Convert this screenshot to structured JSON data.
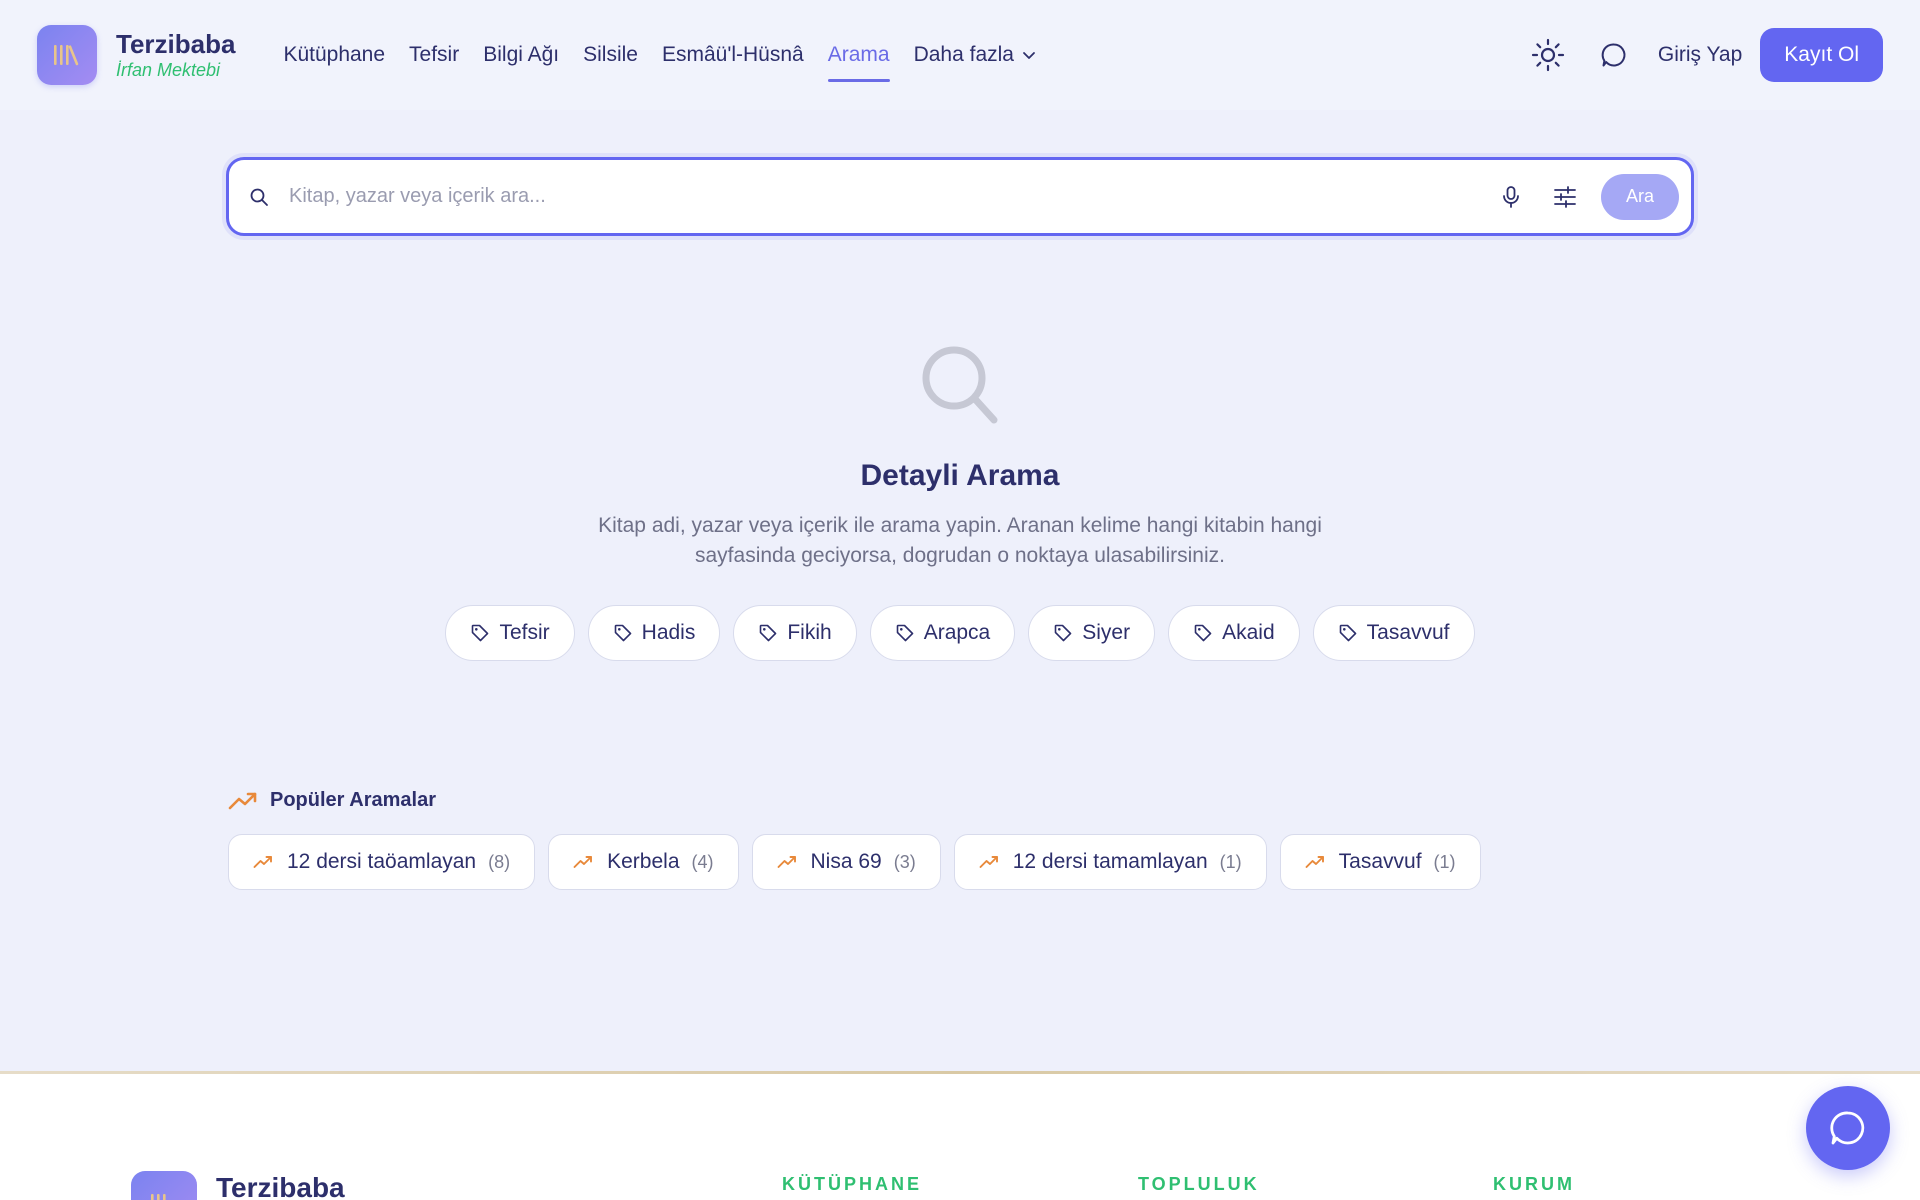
{
  "header": {
    "brand_name": "Terzibaba",
    "brand_sub": "İrfan Mektebi",
    "nav": [
      {
        "label": "Kütüphane"
      },
      {
        "label": "Tefsir"
      },
      {
        "label": "Bilgi Ağı"
      },
      {
        "label": "Silsile"
      },
      {
        "label": "Esmâü'l-Hüsnâ"
      },
      {
        "label": "Arama",
        "active": true
      },
      {
        "label": "Daha fazla"
      }
    ],
    "login_label": "Giriş Yap",
    "register_label": "Kayıt Ol"
  },
  "search": {
    "placeholder": "Kitap, yazar veya içerik ara...",
    "value": "",
    "button_label": "Ara"
  },
  "empty_state": {
    "title": "Detayli Arama",
    "description": "Kitap adi, yazar veya içerik ile arama yapin. Aranan kelime hangi kitabin hangi sayfasinda geciyorsa, dogrudan o noktaya ulasabilirsiniz.",
    "tags": [
      "Tefsir",
      "Hadis",
      "Fikih",
      "Arapca",
      "Siyer",
      "Akaid",
      "Tasavvuf"
    ]
  },
  "popular": {
    "title": "Popüler Aramalar",
    "items": [
      {
        "query": "12 dersi taöamlayan",
        "count": "(8)"
      },
      {
        "query": "Kerbela",
        "count": "(4)"
      },
      {
        "query": "Nisa 69",
        "count": "(3)"
      },
      {
        "query": "12 dersi tamamlayan",
        "count": "(1)"
      },
      {
        "query": "Tasavvuf",
        "count": "(1)"
      }
    ]
  },
  "footer": {
    "brand_name": "Terzibaba",
    "columns": [
      "KÜTÜPHANE",
      "TOPLULUK",
      "KURUM"
    ]
  },
  "colors": {
    "accent": "#6366f1",
    "brand_green": "#2fbf71",
    "trend_orange": "#e8893a",
    "page_bg": "#eef0fb"
  },
  "icons": {
    "logo": "library-books-icon",
    "theme": "sun-icon",
    "chat": "message-circle-icon",
    "search": "search-icon",
    "mic": "microphone-icon",
    "filters": "sliders-icon",
    "tag": "tag-icon",
    "trending": "trending-up-icon"
  }
}
